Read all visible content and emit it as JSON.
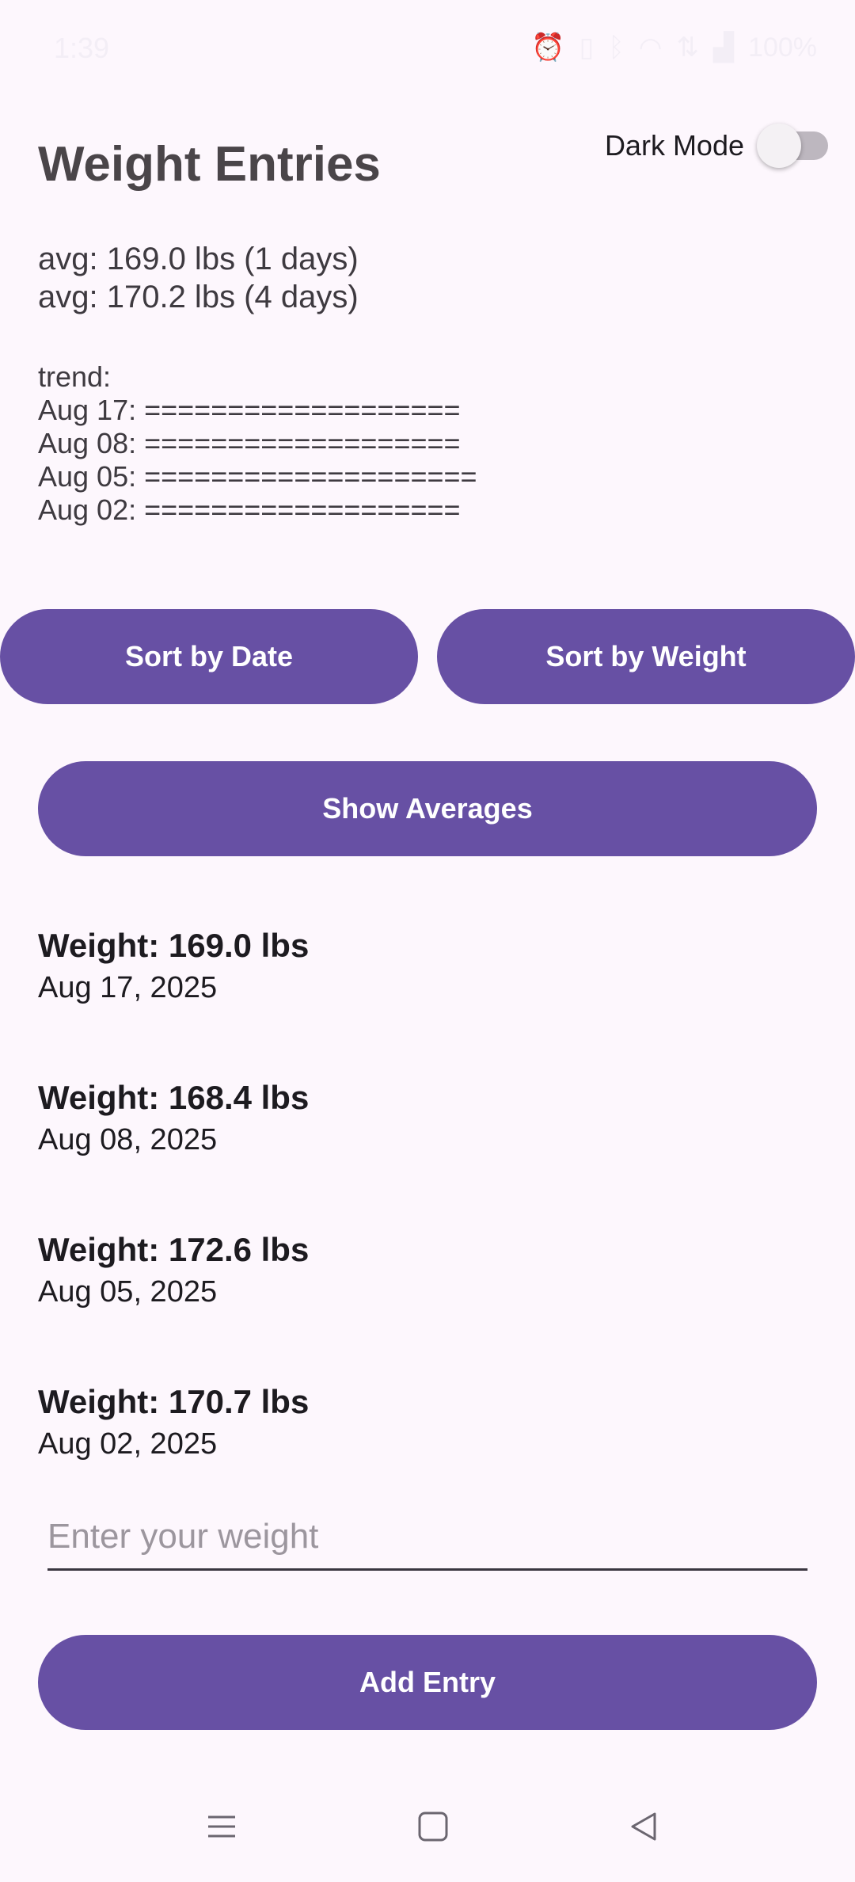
{
  "status_bar": {
    "time": "1:39",
    "battery": "100%",
    "icons": [
      "alarm-icon",
      "vibrate-icon",
      "bluetooth-icon",
      "wifi-icon",
      "data-icon",
      "signal-icon"
    ]
  },
  "header": {
    "title": "Weight Entries",
    "dark_mode_label": "Dark Mode",
    "dark_mode_on": false
  },
  "averages": [
    "avg: 169.0 lbs (1 days)",
    "avg: 170.2 lbs (4 days)"
  ],
  "trend": {
    "label": "trend:",
    "lines": [
      "Aug 17: ===================",
      "Aug 08: ===================",
      "Aug 05: ====================",
      "Aug 02: ==================="
    ]
  },
  "buttons": {
    "sort_by_date": "Sort by Date",
    "sort_by_weight": "Sort by Weight",
    "show_averages": "Show Averages",
    "add_entry": "Add Entry"
  },
  "entries": [
    {
      "weight": "Weight: 169.0 lbs",
      "date": "Aug 17, 2025"
    },
    {
      "weight": "Weight: 168.4 lbs",
      "date": "Aug 08, 2025"
    },
    {
      "weight": "Weight: 172.6 lbs",
      "date": "Aug 05, 2025"
    },
    {
      "weight": "Weight: 170.7 lbs",
      "date": "Aug 02, 2025"
    }
  ],
  "input": {
    "placeholder": "Enter your weight",
    "value": ""
  },
  "colors": {
    "accent": "#6750a4",
    "background": "#fdf7fd"
  }
}
